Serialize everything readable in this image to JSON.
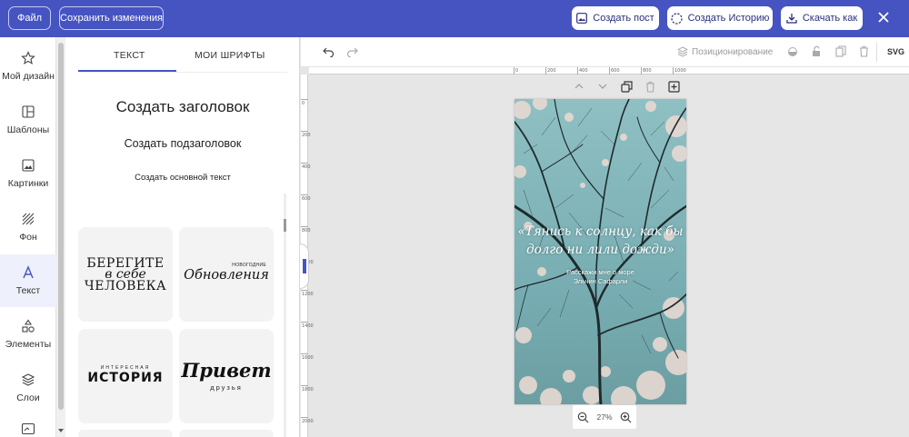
{
  "topbar": {
    "file_label": "Файл",
    "save_label": "Сохранить изменения",
    "create_post_label": "Создать пост",
    "create_story_label": "Создать Историю",
    "download_label": "Скачать как",
    "close_icon": "close-icon"
  },
  "rail": {
    "items": [
      {
        "label": "Мой дизайн",
        "icon": "star-icon"
      },
      {
        "label": "Шаблоны",
        "icon": "templates-icon"
      },
      {
        "label": "Картинки",
        "icon": "image-icon"
      },
      {
        "label": "Фон",
        "icon": "background-icon"
      },
      {
        "label": "Текст",
        "icon": "text-icon",
        "active": true
      },
      {
        "label": "Элементы",
        "icon": "shapes-icon"
      },
      {
        "label": "Слои",
        "icon": "layers-icon"
      }
    ]
  },
  "panel": {
    "tabs": [
      "ТЕКСТ",
      "МОИ ШРИФТЫ"
    ],
    "heading": "Создать заголовок",
    "subheading": "Создать подзаголовок",
    "body": "Создать основной текст",
    "templates": {
      "t1": {
        "line1": "БЕРЕГИТЕ",
        "line2": "в себе",
        "line3": "ЧЕЛОВЕКА"
      },
      "t2": {
        "small": "НОВОГОДНИЕ",
        "big": "Обновления"
      },
      "t3": {
        "small": "ИНТЕРЕСНАЯ",
        "big": "ИСТОРИЯ"
      },
      "t4": {
        "big": "Привет",
        "small": "друзья"
      }
    }
  },
  "canvas_toolbar": {
    "positioning_label": "Позиционирование",
    "svg_label": "SVG"
  },
  "ruler": {
    "top": [
      "0",
      "200",
      "400",
      "600",
      "800",
      "1000"
    ],
    "left": [
      "0",
      "200",
      "400",
      "600",
      "800",
      "1000",
      "1200",
      "1400",
      "1600",
      "1800",
      "2000"
    ]
  },
  "design": {
    "quote": "«Тянись к солнцу, как бы долго ни лили дожди»",
    "author_line1": "Расскажи мне о море",
    "author_line2": "Эльчин Сафарли"
  },
  "zoom": {
    "value": "27%"
  },
  "colors": {
    "brand": "#4654c2",
    "sky": "#7fb3b8"
  }
}
